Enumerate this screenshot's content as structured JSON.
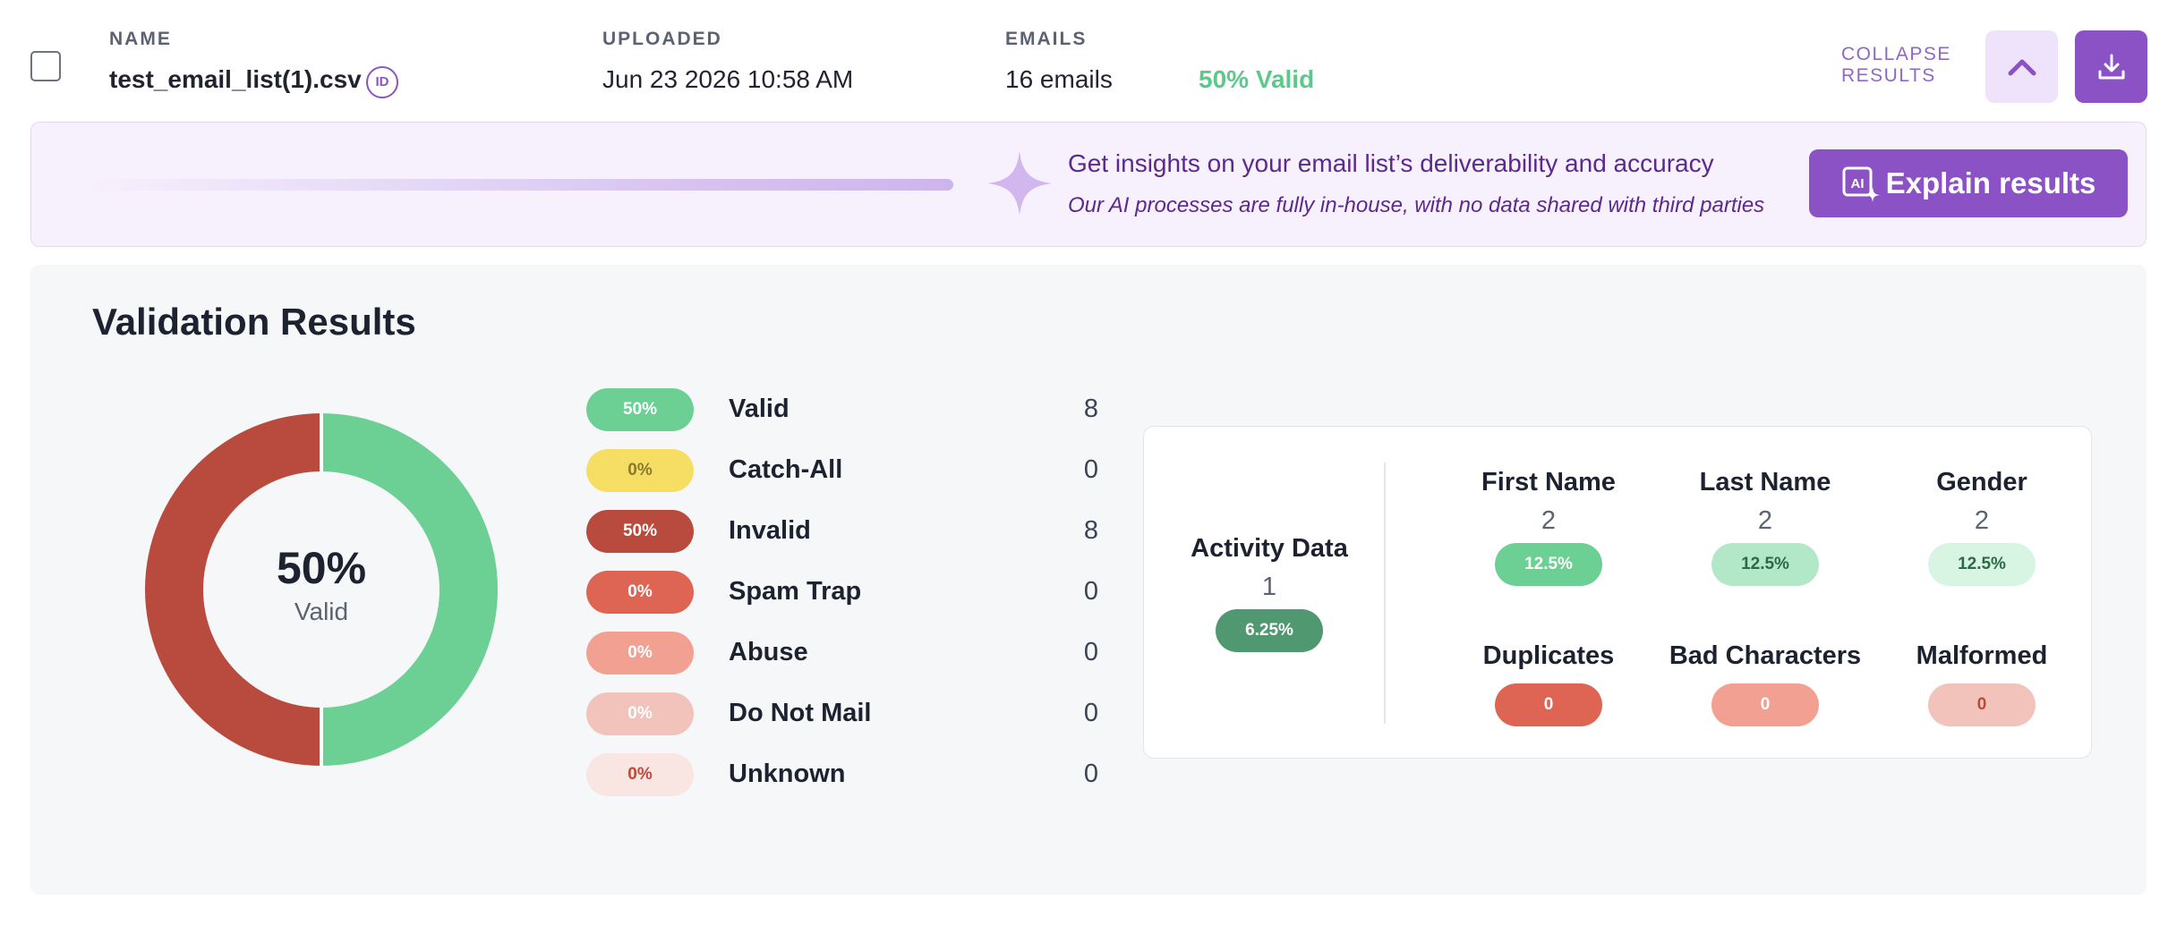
{
  "file": {
    "name_label": "NAME",
    "name": "test_email_list(1).csv",
    "id_badge": "ID",
    "uploaded_label": "UPLOADED",
    "uploaded": "Jun 23 2026 10:58 AM",
    "emails_label": "EMAILS",
    "emails_count": "16 emails",
    "valid_pct": "50% Valid",
    "collapse_line1": "COLLAPSE",
    "collapse_line2": "RESULTS"
  },
  "banner": {
    "title": "Get insights on your email list’s deliverability and accuracy",
    "subtitle": "Our AI processes are fully in-house, with no data shared with third parties",
    "button_label": "Explain results",
    "button_icon_text": "AI"
  },
  "results": {
    "title": "Validation Results",
    "donut": {
      "center_value": "50%",
      "center_label": "Valid",
      "segments": [
        {
          "label": "Valid",
          "fraction": 0.5,
          "color": "#6ccf93"
        },
        {
          "label": "Invalid",
          "fraction": 0.5,
          "color": "#b84b3d"
        }
      ]
    },
    "legend": [
      {
        "pct": "50%",
        "label": "Valid",
        "count": "8",
        "bg": "#6ccf93",
        "fg": "#ffffff"
      },
      {
        "pct": "0%",
        "label": "Catch-All",
        "count": "0",
        "bg": "#f6de64",
        "fg": "#8a7a2c"
      },
      {
        "pct": "50%",
        "label": "Invalid",
        "count": "8",
        "bg": "#b84b3d",
        "fg": "#ffffff"
      },
      {
        "pct": "0%",
        "label": "Spam Trap",
        "count": "0",
        "bg": "#de6554",
        "fg": "#ffffff"
      },
      {
        "pct": "0%",
        "label": "Abuse",
        "count": "0",
        "bg": "#f2a092",
        "fg": "#ffffff"
      },
      {
        "pct": "0%",
        "label": "Do Not Mail",
        "count": "0",
        "bg": "#f1c3bb",
        "fg": "#ffffff"
      },
      {
        "pct": "0%",
        "label": "Unknown",
        "count": "0",
        "bg": "#f9e6e2",
        "fg": "#c0483a"
      }
    ],
    "stats": {
      "activity": {
        "title": "Activity Data",
        "count": "1",
        "pct": "6.25%",
        "bg": "#4f9870",
        "fg": "#ffffff"
      },
      "first_name": {
        "title": "First Name",
        "count": "2",
        "pct": "12.5%",
        "bg": "#6ccf93",
        "fg": "#ffffff"
      },
      "last_name": {
        "title": "Last Name",
        "count": "2",
        "pct": "12.5%",
        "bg": "#b2e8c8",
        "fg": "#2c6a46"
      },
      "gender": {
        "title": "Gender",
        "count": "2",
        "pct": "12.5%",
        "bg": "#d8f4e3",
        "fg": "#2c6a46"
      },
      "duplicates": {
        "title": "Duplicates",
        "pct": "0",
        "bg": "#de6554",
        "fg": "#ffffff"
      },
      "bad_characters": {
        "title": "Bad Characters",
        "pct": "0",
        "bg": "#f2a092",
        "fg": "#ffffff"
      },
      "malformed": {
        "title": "Malformed",
        "pct": "0",
        "bg": "#f1c3bb",
        "fg": "#b84b3d"
      }
    }
  },
  "colors": {
    "brand_purple": "#8a52c4",
    "valid_green": "#5cc98a",
    "invalid_red": "#b84b3d"
  },
  "icons": {
    "checkbox": "checkbox-icon",
    "id": "id-badge-icon",
    "collapse": "chevron-up-icon",
    "download": "download-icon",
    "sparkle": "sparkle-icon",
    "ai": "ai-sparkle-icon"
  }
}
